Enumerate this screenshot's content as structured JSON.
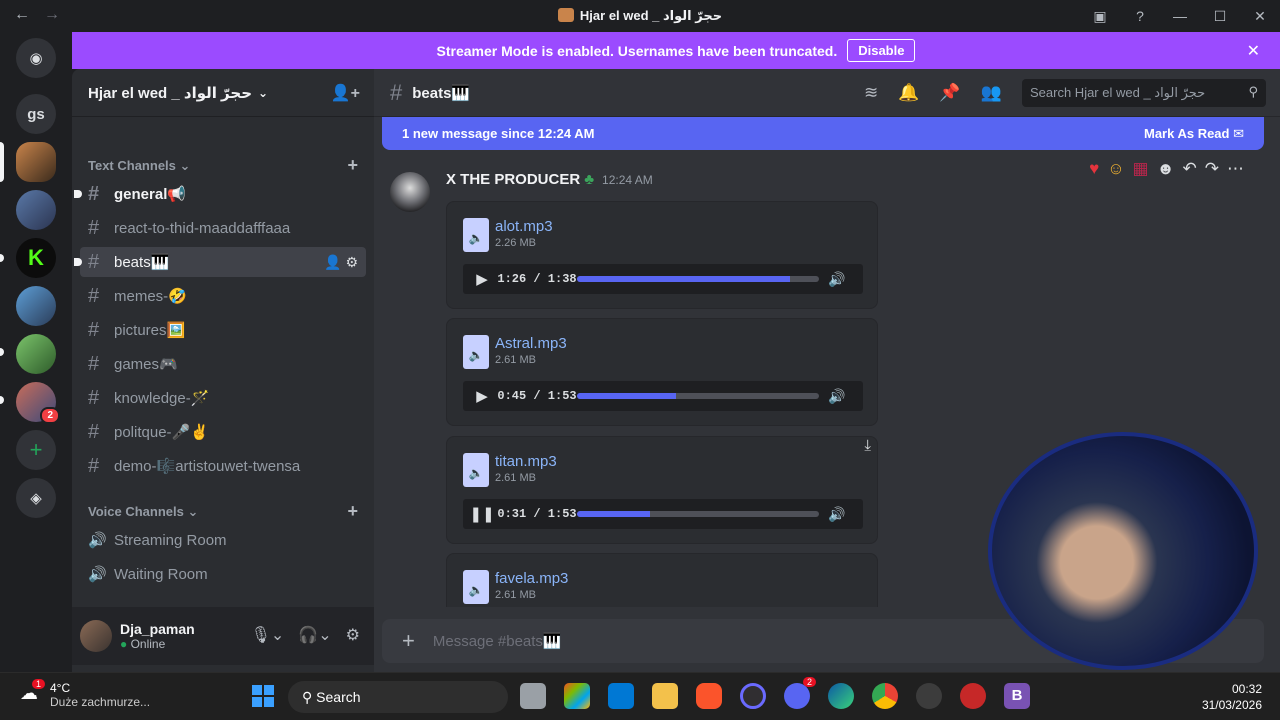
{
  "window": {
    "title": "Hjar el wed _ حجرّ الواد"
  },
  "banner": {
    "text": "Streamer Mode is enabled. Usernames have been truncated.",
    "button": "Disable"
  },
  "rail": {
    "text_server": "gs",
    "notification_badge": "2"
  },
  "server": {
    "name": "Hjar el wed _ حجرّ الواد"
  },
  "categories": {
    "text": "Text Channels",
    "voice": "Voice Channels"
  },
  "channels": [
    {
      "name": "general📢"
    },
    {
      "name": "react-to-thid-maaddafffaaa"
    },
    {
      "name": "beats🎹"
    },
    {
      "name": "memes-🤣"
    },
    {
      "name": "pictures🖼️"
    },
    {
      "name": "games🎮"
    },
    {
      "name": "knowledge-🪄"
    },
    {
      "name": "politque-🎤✌️"
    },
    {
      "name": "demo-🎼artistouwet-twensa"
    }
  ],
  "voice_channels": [
    {
      "name": "Streaming Room"
    },
    {
      "name": "Waiting Room"
    }
  ],
  "user": {
    "name": "Dja_paman",
    "status": "Online"
  },
  "chat": {
    "channel": "beats🎹",
    "search_placeholder": "Search Hjar el wed _ حجرّ الواد",
    "new_messages": "1 new message since 12:24 AM",
    "mark_read": "Mark As Read",
    "author": "X THE PRODUCER",
    "time": "12:24 AM",
    "composer_placeholder": "Message #beats🎹"
  },
  "attachments": [
    {
      "name": "alot.mp3",
      "size": "2.26 MB",
      "time": "1:26 / 1:38",
      "progress": 0.88
    },
    {
      "name": "Astral.mp3",
      "size": "2.61 MB",
      "time": "0:45 / 1:53",
      "progress": 0.41
    },
    {
      "name": "titan.mp3",
      "size": "2.61 MB",
      "time": "0:31 / 1:53",
      "progress": 0.3
    },
    {
      "name": "favela.mp3",
      "size": "2.61 MB"
    }
  ],
  "taskbar": {
    "temp": "4°C",
    "weather": "Duże zachmurze...",
    "search": "Search",
    "time": "00:32",
    "date": "31/03/2026",
    "discord_badge": "2",
    "weather_badge": "1"
  }
}
